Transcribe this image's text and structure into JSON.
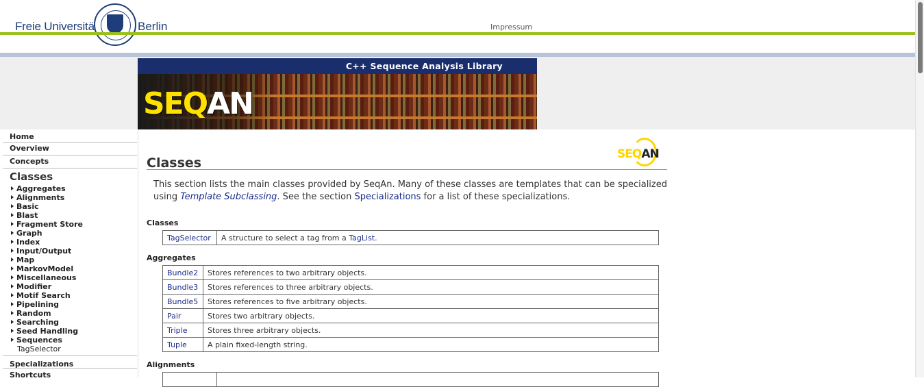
{
  "header": {
    "brand_left": "Freie Universität",
    "brand_right": "Berlin",
    "impressum": "Impressum",
    "banner_title": "C++ Sequence Analysis Library",
    "banner_logo_seq": "SEQ",
    "banner_logo_an": "AN"
  },
  "sidebar": {
    "home": "Home",
    "overview": "Overview",
    "concepts": "Concepts",
    "classes_heading": "Classes",
    "class_items": [
      "Aggregates",
      "Alignments",
      "Basic",
      "Blast",
      "Fragment Store",
      "Graph",
      "Index",
      "Input/Output",
      "Map",
      "MarkovModel",
      "Miscellaneous",
      "Modifier",
      "Motif Search",
      "Pipelining",
      "Random",
      "Searching",
      "Seed Handling",
      "Sequences"
    ],
    "current_item": "TagSelector",
    "specializations": "Specializations",
    "shortcuts": "Shortcuts"
  },
  "main": {
    "logo_seq": "SEQ",
    "logo_an": "AN",
    "title": "Classes",
    "intro_part1": "This section lists the main classes provided by SeqAn. Many of these classes are templates that can be specialized using ",
    "intro_link1": "Template Subclassing",
    "intro_part2": ". See the section ",
    "intro_link2": "Specializations",
    "intro_part3": " for a list of these specializations.",
    "sections": {
      "classes": {
        "heading": "Classes",
        "rows": [
          {
            "name": "TagSelector",
            "desc": "A structure to select a tag from a ",
            "link": "TagList",
            "tail": "."
          }
        ]
      },
      "aggregates": {
        "heading": "Aggregates",
        "rows": [
          {
            "name": "Bundle2",
            "desc": "Stores references to two arbitrary objects."
          },
          {
            "name": "Bundle3",
            "desc": "Stores references to three arbitrary objects."
          },
          {
            "name": "Bundle5",
            "desc": "Stores references to five arbitrary objects."
          },
          {
            "name": "Pair",
            "desc": "Stores two arbitrary objects."
          },
          {
            "name": "Triple",
            "desc": "Stores three arbitrary objects."
          },
          {
            "name": "Tuple",
            "desc": "A plain fixed-length string."
          }
        ]
      },
      "alignments": {
        "heading": "Alignments"
      }
    }
  },
  "colors": {
    "fu_blue": "#1f3d7a",
    "fu_green": "#99c11a",
    "banner_bar": "#1a2e6e",
    "link": "#1a2a8a",
    "seqan_yellow": "#ffe100"
  }
}
